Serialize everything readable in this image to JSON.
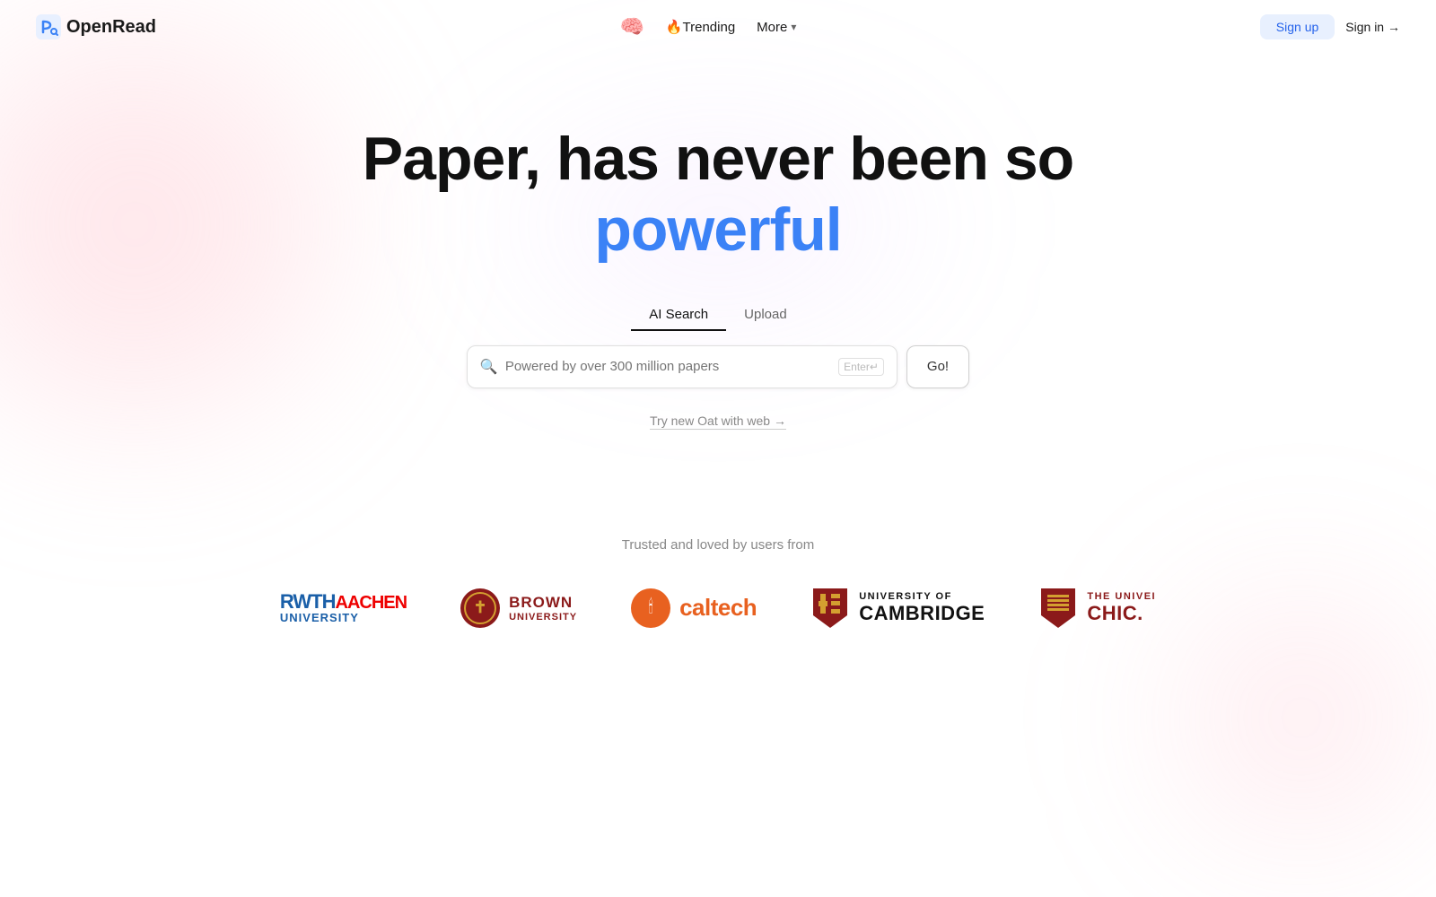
{
  "site": {
    "name": "OpenRead"
  },
  "navbar": {
    "logo_text": "OpenRead",
    "trending_label": "🔥Trending",
    "more_label": "More",
    "signup_label": "Sign up",
    "signin_label": "Sign in →"
  },
  "hero": {
    "headline_part1": "Paper, has never been so",
    "headline_part2": "powerful",
    "tabs": [
      {
        "id": "ai-search",
        "label": "AI Search",
        "active": true
      },
      {
        "id": "upload",
        "label": "Upload",
        "active": false
      }
    ],
    "search_placeholder": "Powered by over 300 million papers",
    "search_enter_badge": "Enter↵",
    "go_button_label": "Go!",
    "oat_link_text": "Try new Oat with web →"
  },
  "trusted": {
    "label": "Trusted and loved by users from",
    "universities": [
      {
        "id": "rwth",
        "name": "RWTH AACHEN UNIVERSITY"
      },
      {
        "id": "brown",
        "name": "BROWN UNIVERSITY"
      },
      {
        "id": "caltech",
        "name": "Caltech"
      },
      {
        "id": "cambridge",
        "name": "UNIVERSITY OF CAMBRIDGE"
      },
      {
        "id": "chicago",
        "name": "THE UNIVERSITY OF CHICAGO"
      }
    ]
  },
  "icons": {
    "search": "🔍",
    "trending": "🔥",
    "brain": "🧠",
    "chevron": "▾",
    "arrow_right": "→",
    "torch": "🕯️"
  }
}
